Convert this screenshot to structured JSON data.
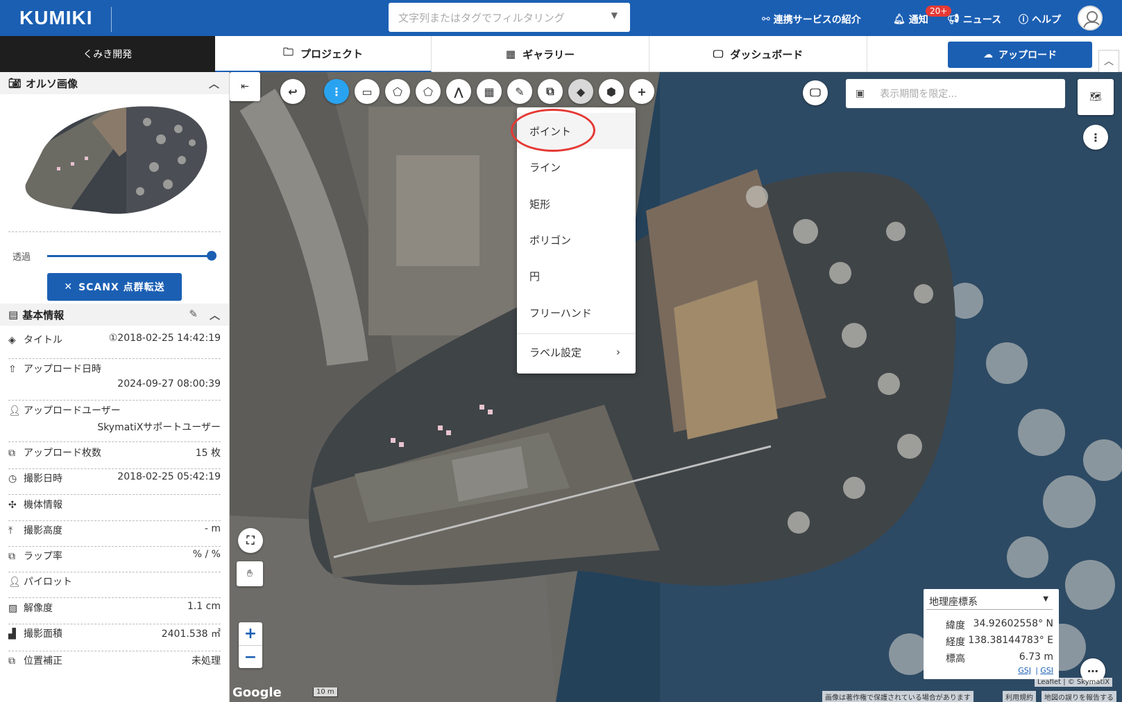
{
  "header": {
    "logo": "KUMIKI",
    "filter_placeholder": "文字列またはタグでフィルタリング",
    "services": "連携サービスの紹介",
    "notifications": "通知",
    "notif_badge": "20+",
    "news": "ニュース",
    "help": "ヘルプ"
  },
  "nav": {
    "workspace": "くみき開発",
    "tabs": [
      "プロジェクト",
      "ギャラリー",
      "ダッシュボード"
    ],
    "upload": "アップロード"
  },
  "ortho": {
    "title": "オルソ画像",
    "transparency_label": "透過",
    "transparency": 1.0,
    "scanx_button": "SCANX 点群転送"
  },
  "basic": {
    "title": "基本情報",
    "rows": [
      {
        "icon": "layers-icon",
        "label": "タイトル",
        "value": "①2018-02-25 14:42:19"
      },
      {
        "icon": "upload-cloud-icon",
        "label": "アップロード日時",
        "value": "2024-09-27 08:00:39"
      },
      {
        "icon": "user-icon",
        "label": "アップロードユーザー",
        "value": "SkymatiXサポートユーザー"
      },
      {
        "icon": "images-icon",
        "label": "アップロード枚数",
        "value": "15 枚"
      },
      {
        "icon": "clock-icon",
        "label": "撮影日時",
        "value": "2018-02-25 05:42:19"
      },
      {
        "icon": "drone-icon",
        "label": "機体情報",
        "value": ""
      },
      {
        "icon": "altitude-icon",
        "label": "撮影高度",
        "value": "- m"
      },
      {
        "icon": "overlap-icon",
        "label": "ラップ率",
        "value": "% / %"
      },
      {
        "icon": "pilot-icon",
        "label": "パイロット",
        "value": ""
      },
      {
        "icon": "image-icon",
        "label": "解像度",
        "value": "1.1 cm"
      },
      {
        "icon": "area-icon",
        "label": "撮影面積",
        "value": "2401.538 ㎡"
      },
      {
        "icon": "position-icon",
        "label": "位置補正",
        "value": "未処理"
      }
    ]
  },
  "map": {
    "date_placeholder": "表示期間を限定...",
    "draw_menu": [
      "ポイント",
      "ライン",
      "矩形",
      "ポリゴン",
      "円",
      "フリーハンド",
      "ラベル設定"
    ],
    "coord_system": "地理座標系",
    "lat_label": "緯度",
    "lat": "34.92602558° N",
    "lng_label": "経度",
    "lng": "138.38144783° E",
    "elev_label": "標高",
    "elev": "6.73 m",
    "gsj": "GSJ",
    "gsi": "GSI",
    "attribution": "Leaflet | © SkymatiX",
    "google": "Google",
    "scale": "10 m",
    "footer_copyright": "画像は著作権で保護されている場合があります",
    "footer_terms": "利用規約",
    "footer_report": "地図の誤りを報告する"
  }
}
